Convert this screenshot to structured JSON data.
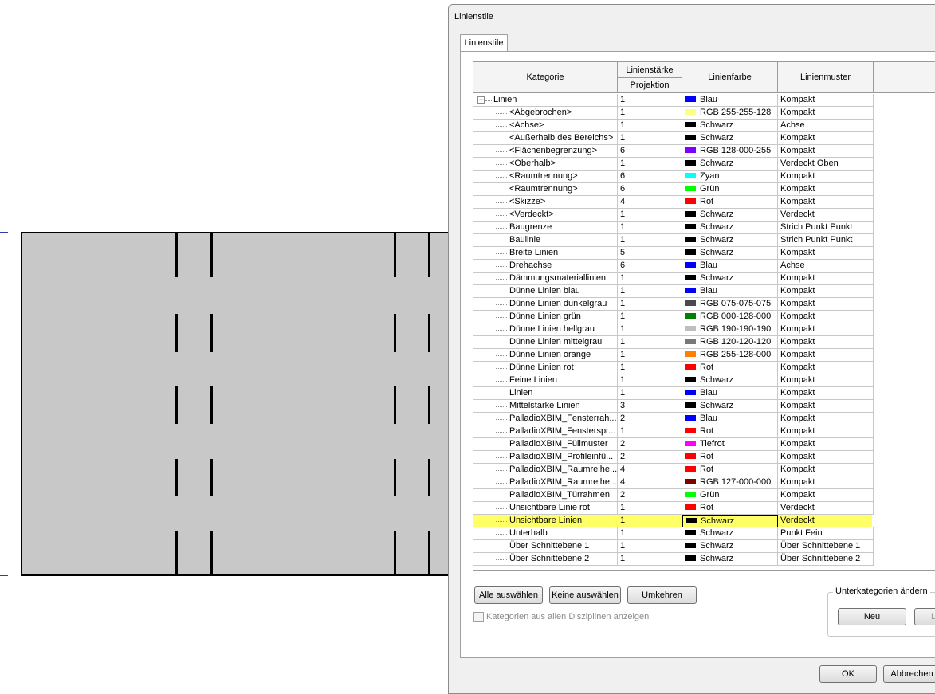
{
  "dialog": {
    "title": "Linienstile",
    "tab": "Linienstile"
  },
  "table": {
    "headers": {
      "category": "Kategorie",
      "weight": "Linienstärke",
      "projection": "Projektion",
      "color": "Linienfarbe",
      "pattern": "Linienmuster"
    },
    "rows": [
      {
        "name": "Linien",
        "weight": "1",
        "color": "Blau",
        "hex": "#0000ff",
        "pattern": "Kompakt",
        "root": true
      },
      {
        "name": "<Abgebrochen>",
        "weight": "1",
        "color": "RGB 255-255-128",
        "hex": "#ffff80",
        "pattern": "Kompakt"
      },
      {
        "name": "<Achse>",
        "weight": "1",
        "color": "Schwarz",
        "hex": "#000000",
        "pattern": "Achse"
      },
      {
        "name": "<Außerhalb des Bereichs>",
        "weight": "1",
        "color": "Schwarz",
        "hex": "#000000",
        "pattern": "Kompakt"
      },
      {
        "name": "<Flächenbegrenzung>",
        "weight": "6",
        "color": "RGB 128-000-255",
        "hex": "#8000ff",
        "pattern": "Kompakt"
      },
      {
        "name": "<Oberhalb>",
        "weight": "1",
        "color": "Schwarz",
        "hex": "#000000",
        "pattern": "Verdeckt Oben"
      },
      {
        "name": "<Raumtrennung>",
        "weight": "6",
        "color": "Zyan",
        "hex": "#00ffff",
        "pattern": "Kompakt"
      },
      {
        "name": "<Raumtrennung>",
        "weight": "6",
        "color": "Grün",
        "hex": "#00ff00",
        "pattern": "Kompakt"
      },
      {
        "name": "<Skizze>",
        "weight": "4",
        "color": "Rot",
        "hex": "#ff0000",
        "pattern": "Kompakt"
      },
      {
        "name": "<Verdeckt>",
        "weight": "1",
        "color": "Schwarz",
        "hex": "#000000",
        "pattern": "Verdeckt"
      },
      {
        "name": "Baugrenze",
        "weight": "1",
        "color": "Schwarz",
        "hex": "#000000",
        "pattern": "Strich Punkt Punkt"
      },
      {
        "name": "Baulinie",
        "weight": "1",
        "color": "Schwarz",
        "hex": "#000000",
        "pattern": "Strich Punkt Punkt"
      },
      {
        "name": "Breite Linien",
        "weight": "5",
        "color": "Schwarz",
        "hex": "#000000",
        "pattern": "Kompakt"
      },
      {
        "name": "Drehachse",
        "weight": "6",
        "color": "Blau",
        "hex": "#0000ff",
        "pattern": "Achse"
      },
      {
        "name": "Dämmungsmateriallinien",
        "weight": "1",
        "color": "Schwarz",
        "hex": "#000000",
        "pattern": "Kompakt"
      },
      {
        "name": "Dünne Linien blau",
        "weight": "1",
        "color": "Blau",
        "hex": "#0000ff",
        "pattern": "Kompakt"
      },
      {
        "name": "Dünne Linien dunkelgrau",
        "weight": "1",
        "color": "RGB 075-075-075",
        "hex": "#4b4b4b",
        "pattern": "Kompakt"
      },
      {
        "name": "Dünne Linien grün",
        "weight": "1",
        "color": "RGB 000-128-000",
        "hex": "#008000",
        "pattern": "Kompakt"
      },
      {
        "name": "Dünne Linien hellgrau",
        "weight": "1",
        "color": "RGB 190-190-190",
        "hex": "#bebebe",
        "pattern": "Kompakt"
      },
      {
        "name": "Dünne Linien mittelgrau",
        "weight": "1",
        "color": "RGB 120-120-120",
        "hex": "#787878",
        "pattern": "Kompakt"
      },
      {
        "name": "Dünne Linien orange",
        "weight": "1",
        "color": "RGB 255-128-000",
        "hex": "#ff8000",
        "pattern": "Kompakt"
      },
      {
        "name": "Dünne Linien rot",
        "weight": "1",
        "color": "Rot",
        "hex": "#ff0000",
        "pattern": "Kompakt"
      },
      {
        "name": "Feine Linien",
        "weight": "1",
        "color": "Schwarz",
        "hex": "#000000",
        "pattern": "Kompakt"
      },
      {
        "name": "Linien",
        "weight": "1",
        "color": "Blau",
        "hex": "#0000ff",
        "pattern": "Kompakt"
      },
      {
        "name": "Mittelstarke Linien",
        "weight": "3",
        "color": "Schwarz",
        "hex": "#000000",
        "pattern": "Kompakt"
      },
      {
        "name": "PalladioXBIM_Fensterrah...",
        "weight": "2",
        "color": "Blau",
        "hex": "#0000ff",
        "pattern": "Kompakt"
      },
      {
        "name": "PalladioXBIM_Fensterspr...",
        "weight": "1",
        "color": "Rot",
        "hex": "#ff0000",
        "pattern": "Kompakt"
      },
      {
        "name": "PalladioXBIM_Füllmuster",
        "weight": "2",
        "color": "Tiefrot",
        "hex": "#ff00ff",
        "pattern": "Kompakt"
      },
      {
        "name": "PalladioXBIM_Profileinfü...",
        "weight": "2",
        "color": "Rot",
        "hex": "#ff0000",
        "pattern": "Kompakt"
      },
      {
        "name": "PalladioXBIM_Raumreihe...",
        "weight": "4",
        "color": "Rot",
        "hex": "#ff0000",
        "pattern": "Kompakt"
      },
      {
        "name": "PalladioXBIM_Raumreihe...",
        "weight": "4",
        "color": "RGB 127-000-000",
        "hex": "#7f0000",
        "pattern": "Kompakt"
      },
      {
        "name": "PalladioXBIM_Türrahmen",
        "weight": "2",
        "color": "Grün",
        "hex": "#00ff00",
        "pattern": "Kompakt"
      },
      {
        "name": "Unsichtbare Linie rot",
        "weight": "1",
        "color": "Rot",
        "hex": "#ff0000",
        "pattern": "Verdeckt"
      },
      {
        "name": "Unsichtbare Linien",
        "weight": "1",
        "color": "Schwarz",
        "hex": "#000000",
        "pattern": "Verdeckt",
        "highlight": true
      },
      {
        "name": "Unterhalb",
        "weight": "1",
        "color": "Schwarz",
        "hex": "#000000",
        "pattern": "Punkt Fein"
      },
      {
        "name": "Über Schnittebene 1",
        "weight": "1",
        "color": "Schwarz",
        "hex": "#000000",
        "pattern": "Über Schnittebene 1"
      },
      {
        "name": "Über Schnittebene 2",
        "weight": "1",
        "color": "Schwarz",
        "hex": "#000000",
        "pattern": "Über Schnittebene 2"
      }
    ]
  },
  "buttons": {
    "select_all": "Alle auswählen",
    "select_none": "Keine auswählen",
    "invert": "Umkehren",
    "new": "Neu",
    "delete": "Lösc",
    "ok": "OK",
    "cancel": "Abbrechen"
  },
  "subcategory_group": "Unterkategorien ändern",
  "show_all_disciplines": "Kategorien aus allen Disziplinen anzeigen",
  "colors": {
    "highlight": "#ffff66",
    "slab": "#c8c8c8"
  }
}
